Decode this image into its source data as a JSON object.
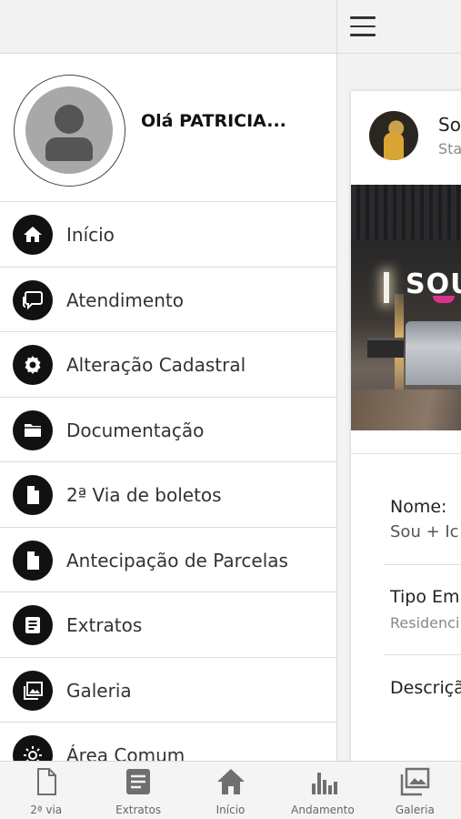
{
  "drawer": {
    "greeting": "Olá PATRICIA...",
    "menu": [
      {
        "label": "Início",
        "icon": "home-icon"
      },
      {
        "label": "Atendimento",
        "icon": "chat-icon"
      },
      {
        "label": "Alteração Cadastral",
        "icon": "gear-icon"
      },
      {
        "label": "Documentação",
        "icon": "folder-icon"
      },
      {
        "label": "2ª Via de boletos",
        "icon": "document-icon"
      },
      {
        "label": "Antecipação de Parcelas",
        "icon": "document-icon"
      },
      {
        "label": "Extratos",
        "icon": "list-icon"
      },
      {
        "label": "Galeria",
        "icon": "gallery-icon"
      },
      {
        "label": "Área Comum",
        "icon": "sun-icon"
      }
    ]
  },
  "background": {
    "card_title": "So",
    "card_subtitle": "Sta",
    "image_logo": "SOU",
    "fields": [
      {
        "label": "Nome:",
        "value": "Sou + Ic"
      },
      {
        "label": "Tipo Em",
        "value": "Residenci"
      },
      {
        "label": "Descriçã",
        "value": ""
      }
    ]
  },
  "bottom_nav": [
    {
      "label": "2ª via",
      "icon": "document-icon"
    },
    {
      "label": "Extratos",
      "icon": "list-icon"
    },
    {
      "label": "Início",
      "icon": "home-icon"
    },
    {
      "label": "Andamento",
      "icon": "bar-chart-icon"
    },
    {
      "label": "Galeria",
      "icon": "gallery-icon"
    }
  ],
  "colors": {
    "icon_circle": "#111111",
    "nav_icon": "#6f6f6f",
    "accent_logo": "#d9328c"
  }
}
